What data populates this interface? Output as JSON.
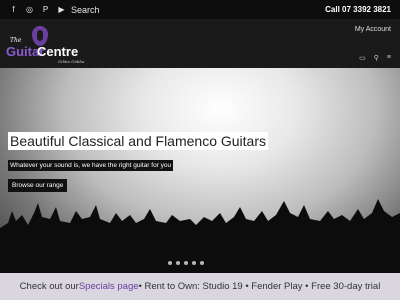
{
  "topbar": {
    "social": [
      {
        "icon": "facebook-icon",
        "glyph": "f"
      },
      {
        "icon": "instagram-icon",
        "glyph": "◎"
      },
      {
        "icon": "pinterest-icon",
        "glyph": "P"
      },
      {
        "icon": "youtube-icon",
        "glyph": "▶"
      }
    ],
    "search_label": "Search",
    "phone": "Call 07 3392 3821"
  },
  "header": {
    "logo": {
      "the": "The",
      "word1": "Guitar",
      "word2": "Centre",
      "tagline": "Gibba Gabba"
    },
    "account_label": "My Account",
    "icons": [
      "cart-icon",
      "search-icon",
      "menu-icon"
    ]
  },
  "hero": {
    "title": "Beautiful Classical and Flamenco Guitars",
    "subtitle": "Whatever your sound is, we have the right guitar for you",
    "button_label": "Browse our range",
    "slides": 5
  },
  "banner": {
    "prefix": "Check out our ",
    "specials": "Specials page",
    "rest": " • Rent to Own: Studio 19 • Fender Play • Free 30-day trial"
  },
  "colors": {
    "accent": "#6b3fa0",
    "topbar": "#0d0d0d",
    "header": "#1a1a1a",
    "banner": "#d9d6df"
  }
}
